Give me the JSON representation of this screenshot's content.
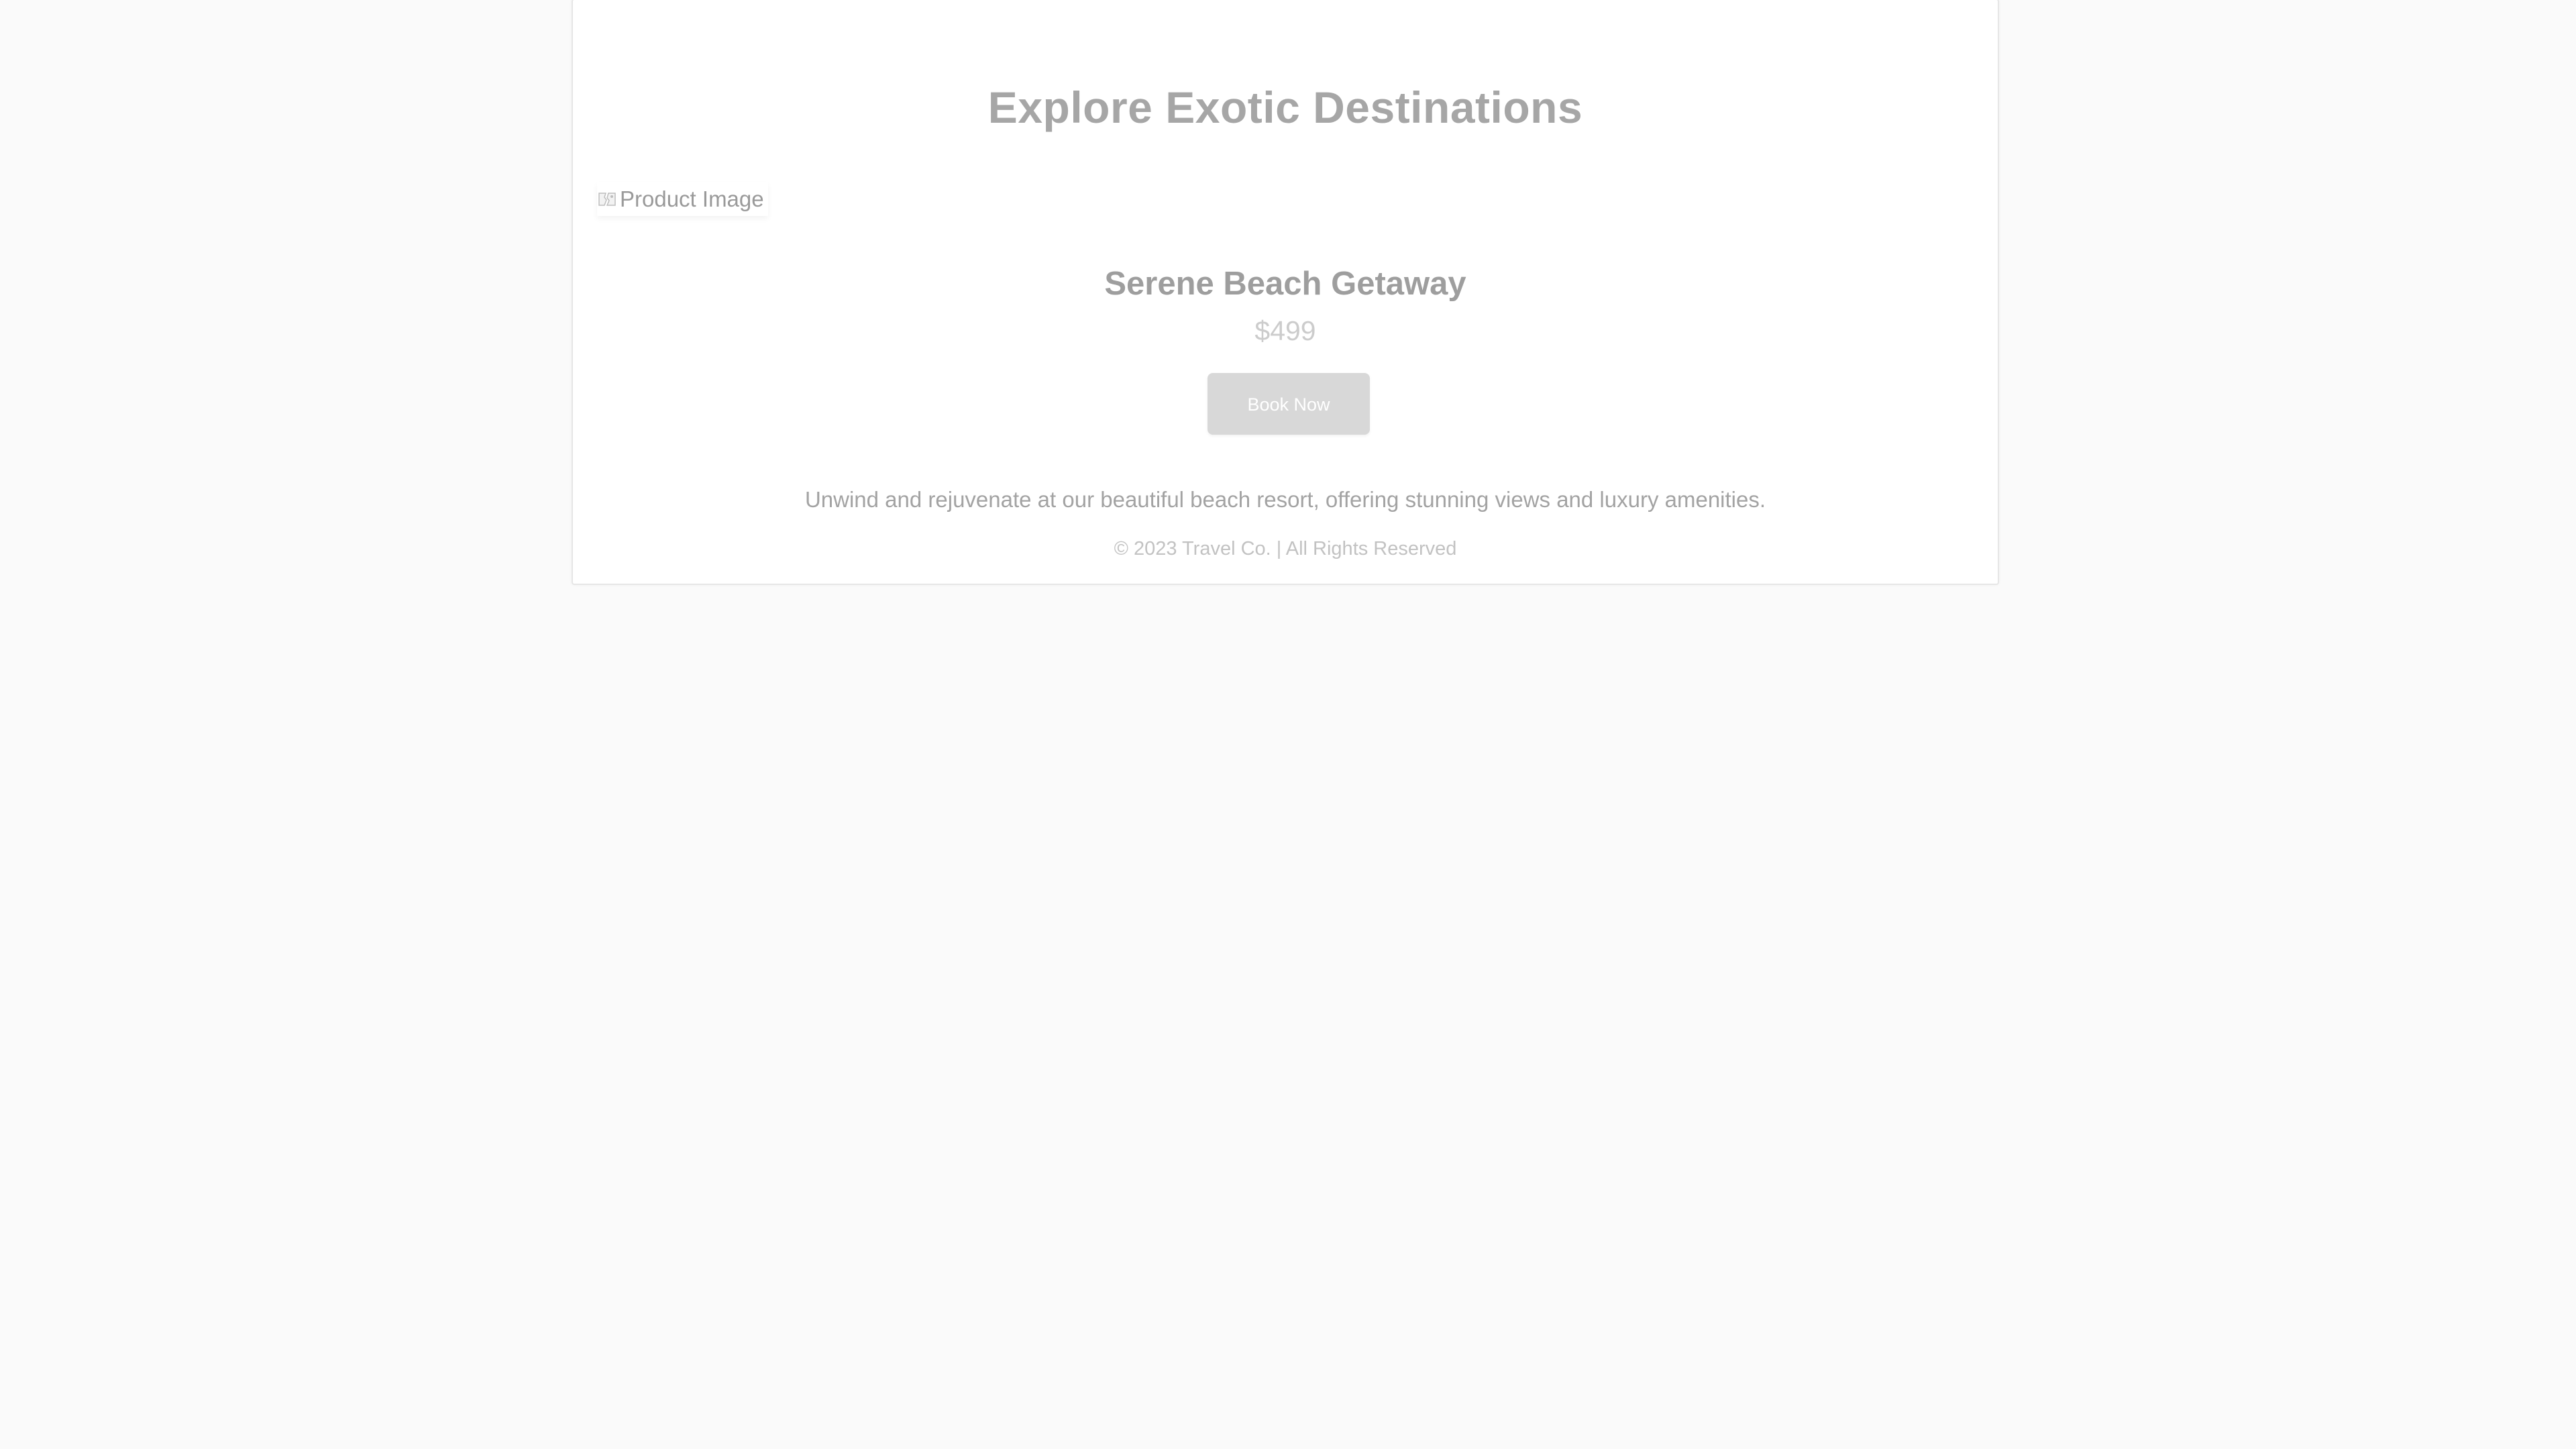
{
  "header": {
    "title": "Explore Exotic Destinations"
  },
  "product": {
    "image_alt": "Product Image",
    "image_icon": "broken-image-icon",
    "name": "Serene Beach Getaway",
    "price": "$499",
    "book_label": "Book Now",
    "description": "Unwind and rejuvenate at our beautiful beach resort, offering stunning views and luxury amenities."
  },
  "footer": {
    "text": "© 2023 Travel Co. | All Rights Reserved"
  },
  "colors": {
    "background": "#fafafa",
    "card": "#ffffff",
    "button": "#d8d8d8",
    "title_text": "#a6a6a6"
  }
}
